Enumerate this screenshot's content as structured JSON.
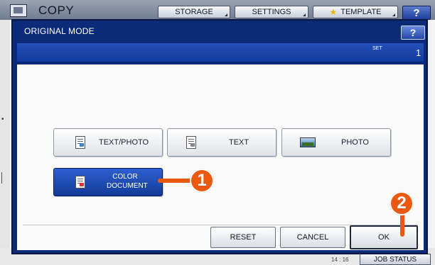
{
  "app": {
    "title": "COPY",
    "top_buttons": [
      "STORAGE",
      "SETTINGS",
      "TEMPLATE"
    ],
    "help_label": "?",
    "clock": "14 : 16",
    "job_status": "JOB STATUS"
  },
  "dialog": {
    "title": "ORIGINAL MODE",
    "help_label": "?",
    "set_label": "SET",
    "set_count": "1",
    "modes": [
      {
        "label": "TEXT/PHOTO",
        "icon": "text-photo-icon",
        "selected": false
      },
      {
        "label": "TEXT",
        "icon": "text-doc-icon",
        "selected": false
      },
      {
        "label": "PHOTO",
        "icon": "photo-icon",
        "selected": false
      },
      {
        "label_line1": "COLOR",
        "label_line2": "DOCUMENT",
        "icon": "color-document-icon",
        "selected": true
      }
    ],
    "actions": {
      "reset": "RESET",
      "cancel": "CANCEL",
      "ok": "OK"
    }
  },
  "callouts": [
    "1",
    "2"
  ],
  "colors": {
    "dialog_frame": "#0b2a78",
    "selected_button": "#1f4cb8",
    "callout": "#e9590f"
  }
}
